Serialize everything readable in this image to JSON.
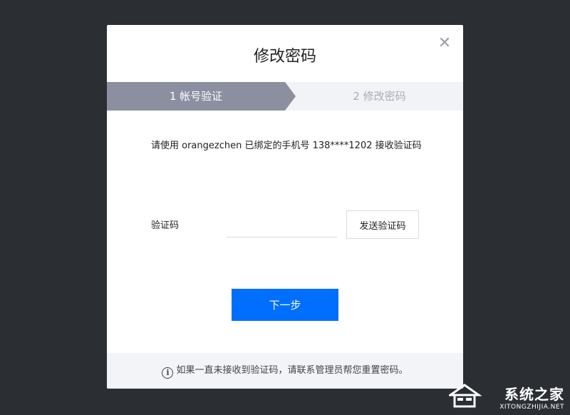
{
  "dialog": {
    "title": "修改密码",
    "close_glyph": "✕"
  },
  "steps": [
    {
      "label": "1 帐号验证",
      "active": true
    },
    {
      "label": "2 修改密码",
      "active": false
    }
  ],
  "info_text": "请使用 orangezchen 已绑定的手机号 138****1202 接收验证码",
  "form": {
    "code_label": "验证码",
    "code_value": "",
    "send_code_label": "发送验证码"
  },
  "next_label": "下一步",
  "footer": {
    "icon": "info-icon",
    "icon_glyph": "i",
    "text": "如果一直未接收到验证码，请联系管理员帮您重置密码。"
  },
  "watermark": {
    "main": "系统之家",
    "sub": "XITONGZHIJIA.NET"
  },
  "colors": {
    "primary": "#006eff",
    "step_active": "#8b8f9f",
    "step_inactive": "#f1f3f6",
    "background": "#2b2e33"
  }
}
